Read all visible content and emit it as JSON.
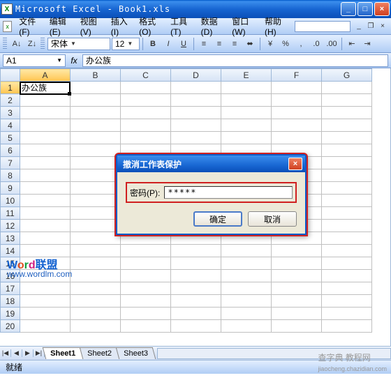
{
  "title": "Microsoft Excel - Book1.xls",
  "menu": {
    "file": "文件(F)",
    "edit": "编辑(E)",
    "view": "视图(V)",
    "insert": "插入(I)",
    "format": "格式(O)",
    "tools": "工具(T)",
    "data": "数据(D)",
    "window": "窗口(W)",
    "help": "帮助(H)"
  },
  "format_toolbar": {
    "font": "宋体",
    "size": "12"
  },
  "namebox": "A1",
  "formula": "办公族",
  "columns": [
    "A",
    "B",
    "C",
    "D",
    "E",
    "F",
    "G"
  ],
  "rows": [
    "1",
    "2",
    "3",
    "4",
    "5",
    "6",
    "7",
    "8",
    "9",
    "10",
    "11",
    "12",
    "13",
    "14",
    "15",
    "16",
    "17",
    "18",
    "19",
    "20"
  ],
  "cells": {
    "A1": "办公族"
  },
  "selected": {
    "col": "A",
    "row": "1"
  },
  "sheets": {
    "s1": "Sheet1",
    "s2": "Sheet2",
    "s3": "Sheet3"
  },
  "status": "就绪",
  "dialog": {
    "title": "撤消工作表保护",
    "label": "密码(P):",
    "value": "*****",
    "ok": "确定",
    "cancel": "取消"
  },
  "watermark": {
    "brand": "Word联盟",
    "url": "www.wordlm.com",
    "site": "查字典 教程网",
    "siteurl": "jiaocheng.chazidian.com"
  }
}
